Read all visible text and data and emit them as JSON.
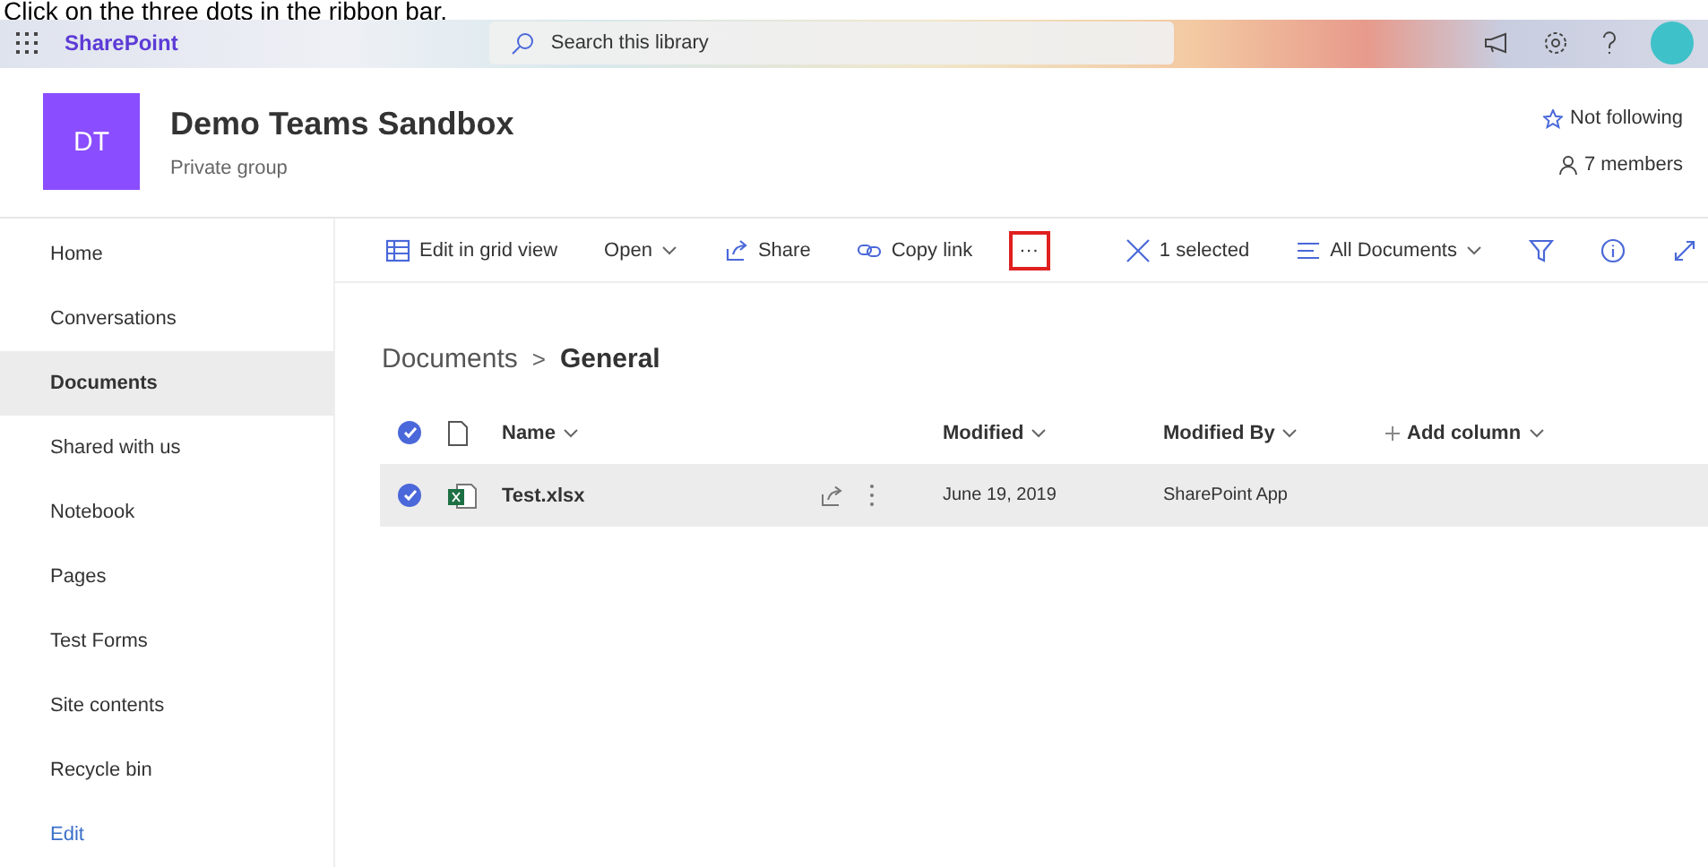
{
  "caption": "Click on the three dots in the ribbon bar.",
  "suite_bar": {
    "app_name": "SharePoint",
    "search": {
      "placeholder": "Search this library"
    }
  },
  "site": {
    "logo": "DT",
    "title": "Demo Teams Sandbox",
    "subtitle": "Private group",
    "follow": "Not following",
    "members": "7 members"
  },
  "nav": [
    {
      "label": "Home",
      "selected": false
    },
    {
      "label": "Conversations",
      "selected": false
    },
    {
      "label": "Documents",
      "selected": true
    },
    {
      "label": "Shared with us",
      "selected": false
    },
    {
      "label": "Notebook",
      "selected": false
    },
    {
      "label": "Pages",
      "selected": false
    },
    {
      "label": "Test Forms",
      "selected": false
    },
    {
      "label": "Site contents",
      "selected": false
    },
    {
      "label": "Recycle bin",
      "selected": false
    },
    {
      "label": "Edit",
      "selected": false,
      "kind": "link"
    }
  ],
  "command_bar": {
    "left": [
      {
        "kind": "grid",
        "label": "Edit in grid view"
      },
      {
        "kind": "open",
        "label": "Open"
      },
      {
        "kind": "share",
        "label": "Share"
      },
      {
        "kind": "link",
        "label": "Copy link"
      },
      {
        "kind": "more",
        "label": "···",
        "highlighted": true
      }
    ],
    "right": [
      {
        "kind": "clear",
        "label": "1 selected"
      },
      {
        "kind": "view",
        "label": "All Documents"
      },
      {
        "kind": "filter"
      },
      {
        "kind": "info"
      },
      {
        "kind": "expand"
      }
    ]
  },
  "breadcrumb": {
    "parent": "Documents",
    "separator": ">",
    "current": "General"
  },
  "table": {
    "all_selected": true,
    "columns": [
      "Name",
      "Modified",
      "Modified By",
      "Add column"
    ],
    "rows": [
      {
        "selected": true,
        "name": "Test.xlsx",
        "modified": "June 19, 2019",
        "modified_by": "SharePoint App"
      }
    ]
  }
}
